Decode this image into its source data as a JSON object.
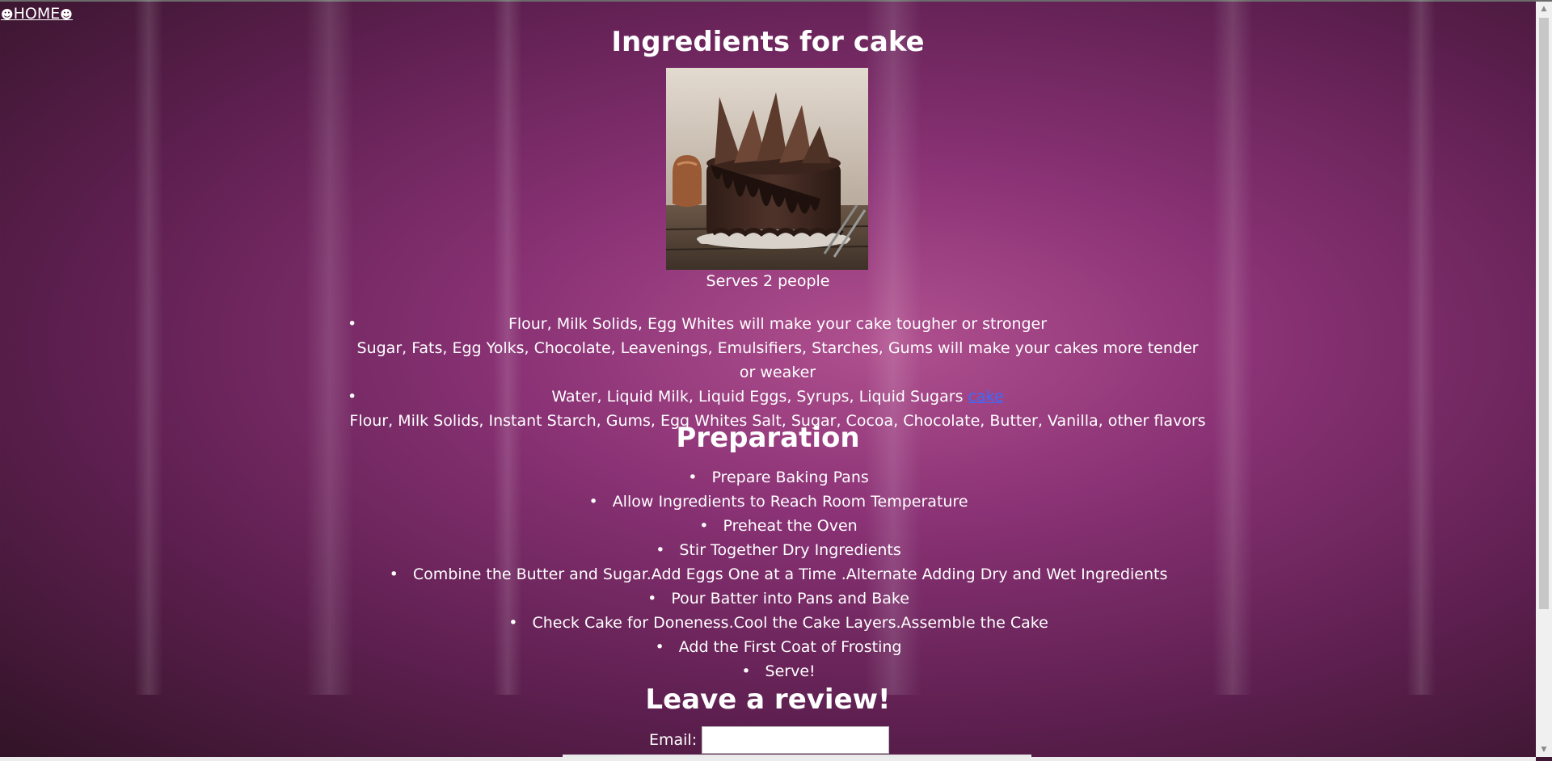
{
  "nav": {
    "home_label": "HOME",
    "smile_glyph": "☻"
  },
  "recipe": {
    "title": "Ingredients for cake",
    "image_alt": "chocolate cake",
    "serves": "Serves 2 people",
    "ingredients": [
      {
        "line1": "Flour, Milk Solids, Egg Whites will make your cake tougher or stronger",
        "line2": "Sugar, Fats, Egg Yolks, Chocolate, Leavenings, Emulsifiers, Starches, Gums will make your cakes more tender or weaker"
      },
      {
        "line1": "Water, Liquid Milk, Liquid Eggs, Syrups, Liquid Sugars",
        "link": "cake",
        "line2": "Flour, Milk Solids, Instant Starch, Gums, Egg Whites Salt, Sugar, Cocoa, Chocolate, Butter, Vanilla, other flavors"
      }
    ]
  },
  "preparation": {
    "title": "Preparation",
    "steps": [
      "Prepare Baking Pans",
      "Allow Ingredients to Reach Room Temperature",
      "Preheat the Oven",
      "Stir Together Dry Ingredients",
      "Combine the Butter and Sugar.Add Eggs One at a Time .Alternate Adding Dry and Wet Ingredients",
      "Pour Batter into Pans and Bake",
      "Check Cake for Doneness.Cool the Cake Layers.Assemble the Cake",
      "Add the First Coat of Frosting",
      "Serve!"
    ]
  },
  "review": {
    "title": "Leave a review!",
    "email_label": "Email:",
    "email_value": ""
  },
  "colors": {
    "link": "#3b6bff",
    "text": "#ffffff",
    "background_center": "#b0508f",
    "background_edge": "#311326"
  }
}
